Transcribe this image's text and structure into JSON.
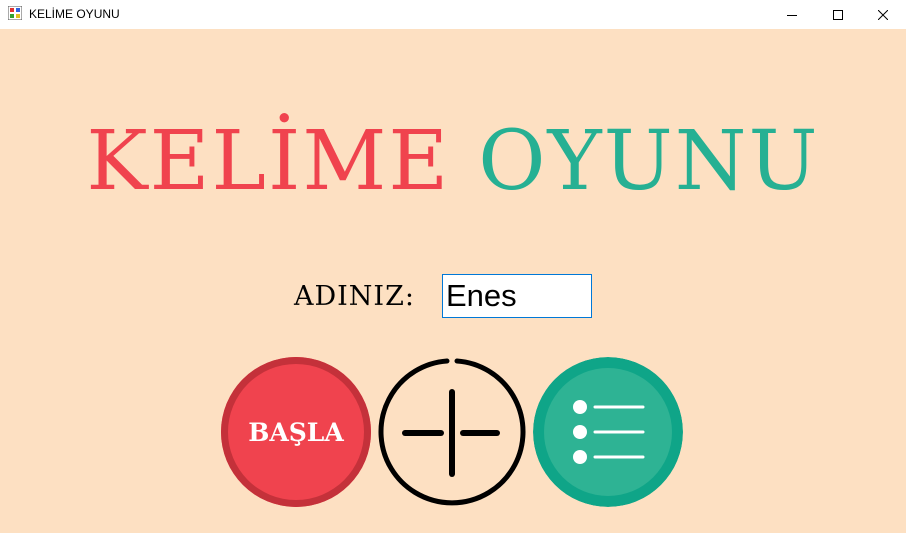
{
  "window": {
    "title": "KELİME OYUNU",
    "controls": [
      "minimize",
      "maximize",
      "close"
    ]
  },
  "header": {
    "word1": "KELİME",
    "word2": "OYUNU"
  },
  "form": {
    "name_label": "ADINIZ:",
    "name_value": "Enes"
  },
  "buttons": {
    "start_label": "BAŞLA",
    "add_icon": "add-icon",
    "list_icon": "list-icon"
  },
  "colors": {
    "background": "#fde0c2",
    "red": "#f0434e",
    "teal": "#26b093"
  }
}
